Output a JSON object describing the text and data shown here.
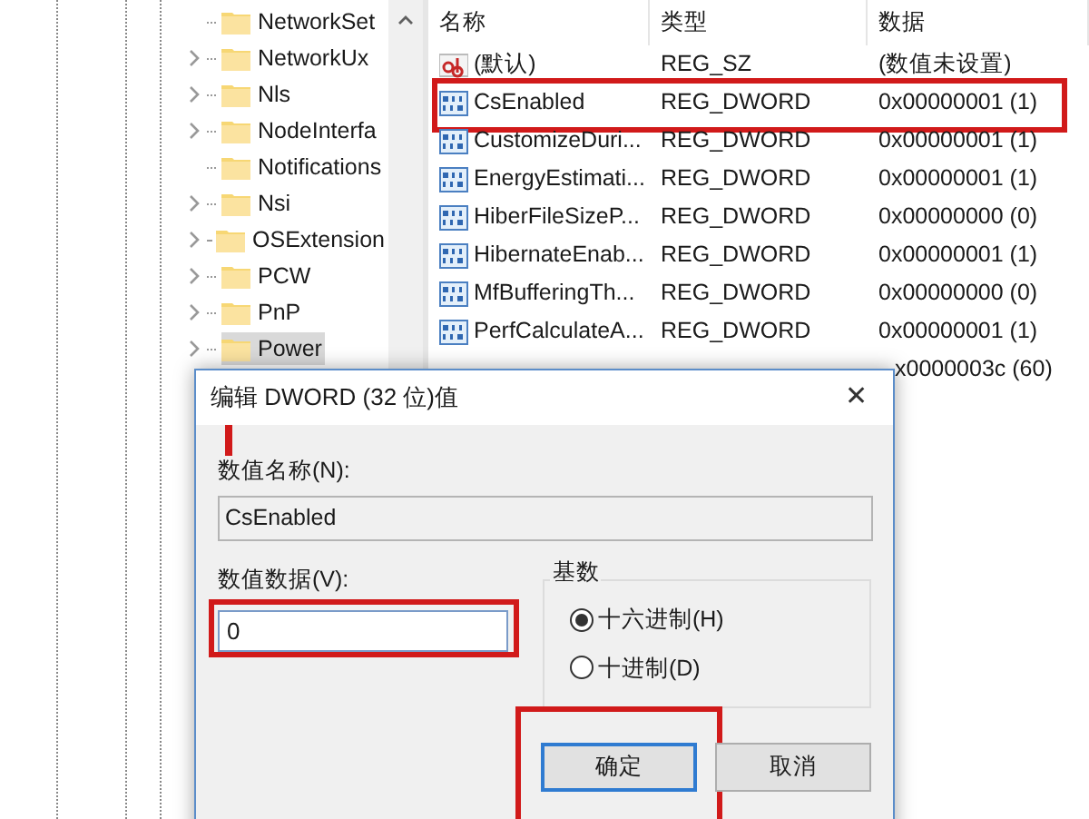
{
  "tree": {
    "items": [
      {
        "label": "NetworkSet",
        "expandable": false,
        "selected": false
      },
      {
        "label": "NetworkUx",
        "expandable": true,
        "selected": false
      },
      {
        "label": "Nls",
        "expandable": true,
        "selected": false
      },
      {
        "label": "NodeInterfa",
        "expandable": true,
        "selected": false
      },
      {
        "label": "Notifications",
        "expandable": false,
        "selected": false
      },
      {
        "label": "Nsi",
        "expandable": true,
        "selected": false
      },
      {
        "label": "OSExtension",
        "expandable": true,
        "selected": false
      },
      {
        "label": "PCW",
        "expandable": true,
        "selected": false
      },
      {
        "label": "PnP",
        "expandable": true,
        "selected": false
      },
      {
        "label": "Power",
        "expandable": true,
        "selected": true
      }
    ]
  },
  "list": {
    "columns": [
      "名称",
      "类型",
      "数据"
    ],
    "rows": [
      {
        "kind": "string",
        "name": "(默认)",
        "type": "REG_SZ",
        "data": "(数值未设置)",
        "highlighted": false
      },
      {
        "kind": "dword",
        "name": "CsEnabled",
        "type": "REG_DWORD",
        "data": "0x00000001 (1)",
        "highlighted": true
      },
      {
        "kind": "dword",
        "name": "CustomizeDuri...",
        "type": "REG_DWORD",
        "data": "0x00000001 (1)",
        "highlighted": false
      },
      {
        "kind": "dword",
        "name": "EnergyEstimati...",
        "type": "REG_DWORD",
        "data": "0x00000001 (1)",
        "highlighted": false
      },
      {
        "kind": "dword",
        "name": "HiberFileSizeP...",
        "type": "REG_DWORD",
        "data": "0x00000000 (0)",
        "highlighted": false
      },
      {
        "kind": "dword",
        "name": "HibernateEnab...",
        "type": "REG_DWORD",
        "data": "0x00000001 (1)",
        "highlighted": false
      },
      {
        "kind": "dword",
        "name": "MfBufferingTh...",
        "type": "REG_DWORD",
        "data": "0x00000000 (0)",
        "highlighted": false
      },
      {
        "kind": "dword",
        "name": "PerfCalculateA...",
        "type": "REG_DWORD",
        "data": "0x00000001 (1)",
        "highlighted": false
      },
      {
        "kind": "covered",
        "data": "x0000003c (60)",
        "highlighted": false
      }
    ]
  },
  "dialog": {
    "title": "编辑 DWORD (32 位)值",
    "close": "✕",
    "name_label": "数值名称(N):",
    "name_label_marked": true,
    "name_value": "CsEnabled",
    "data_label": "数值数据(V):",
    "data_value": "0",
    "data_highlighted": true,
    "base_group": {
      "title": "基数",
      "options": [
        {
          "label": "十六进制(H)",
          "selected": true
        },
        {
          "label": "十进制(D)",
          "selected": false
        }
      ]
    },
    "buttons": [
      {
        "label": "确定",
        "default": true,
        "highlighted": true
      },
      {
        "label": "取消",
        "default": false,
        "highlighted": false
      }
    ]
  }
}
